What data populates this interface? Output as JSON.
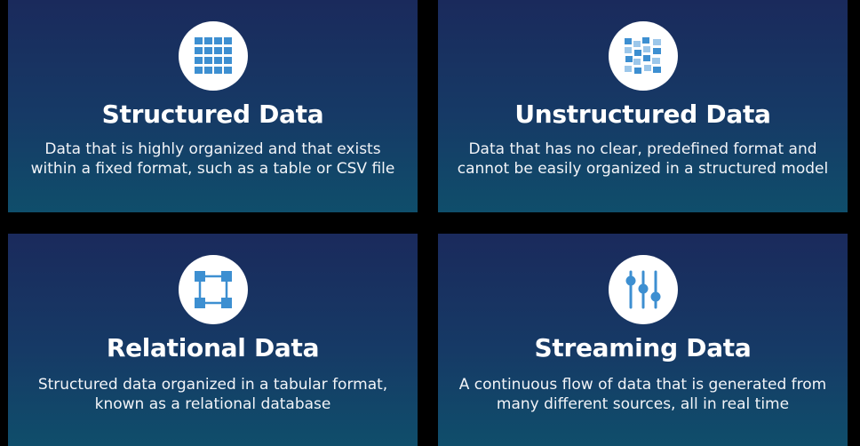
{
  "colors": {
    "background": "#000000",
    "card_gradient_top": "#1a2a5c",
    "card_gradient_bottom": "#0f4e6b",
    "icon_circle": "#ffffff",
    "icon_blue": "#3d8fd1",
    "icon_light_blue": "#9cc7ea"
  },
  "cards": [
    {
      "title": "Structured Data",
      "icon": "grid-table-icon",
      "description_lines": [
        "Data that is highly organized and that exists",
        "within a fixed format, such as a table or CSV file"
      ]
    },
    {
      "title": "Unstructured Data",
      "icon": "scattered-blocks-icon",
      "description_lines": [
        "Data that has no clear, predefined format and",
        "cannot be easily organized in a structured model"
      ]
    },
    {
      "title": "Relational Data",
      "icon": "connected-nodes-icon",
      "description_lines": [
        "Structured data organized in a tabular format,",
        "known as a relational database"
      ]
    },
    {
      "title": "Streaming Data",
      "icon": "sliders-icon",
      "description_lines": [
        "A continuous flow of data that is generated from",
        "many different sources, all in real time"
      ]
    }
  ]
}
